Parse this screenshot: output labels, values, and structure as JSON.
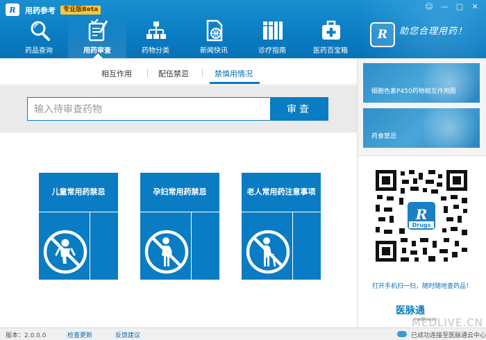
{
  "app": {
    "logo_text": "R",
    "title": "用药参考",
    "edition": "专业版Beta"
  },
  "window_controls": [
    "☺",
    "—",
    "□",
    "✕"
  ],
  "nav": [
    {
      "label": "药品查询",
      "icon": "magnifier-icon"
    },
    {
      "label": "用药审查",
      "icon": "pen-checklist-icon",
      "active": true
    },
    {
      "label": "药物分类",
      "icon": "hierarchy-icon"
    },
    {
      "label": "新闻快讯",
      "icon": "globe-document-icon"
    },
    {
      "label": "诊疗指南",
      "icon": "books-icon"
    },
    {
      "label": "医药百宝箱",
      "icon": "medical-kit-icon"
    }
  ],
  "slogan": {
    "logo_text": "R",
    "text": "助您合理用药！"
  },
  "tabs": [
    {
      "label": "相互作用",
      "active": false
    },
    {
      "label": "配伍禁忌",
      "active": false
    },
    {
      "label": "禁慎用情况",
      "active": true
    }
  ],
  "search": {
    "placeholder": "输入待审查药物",
    "value": "",
    "button": "审查"
  },
  "cards": [
    {
      "title": "儿童常用药禁忌",
      "icon": "no-child-icon"
    },
    {
      "title": "孕妇常用药禁忌",
      "icon": "no-pregnant-woman-icon"
    },
    {
      "title": "老人常用药注意事项",
      "icon": "no-elderly-icon"
    }
  ],
  "sidebar": {
    "banners": [
      "细胞色素P450药物相互作用图",
      "药食禁忌"
    ],
    "qr_badge": "Drugs",
    "qr_caption": "打开手机扫一扫，随时随地查药品！",
    "partner": {
      "name": "医脉通",
      "sub": "medlive.cn"
    }
  },
  "status": {
    "version": "版本：2.0.0.0",
    "check_update": "检查更新",
    "feedback": "反馈建议",
    "connection": "已成功连接至医脉通云中心"
  },
  "watermark": "MEDLIVE.CN",
  "colors": {
    "primary": "#0a7cc3",
    "accent": "#f5c93b"
  }
}
